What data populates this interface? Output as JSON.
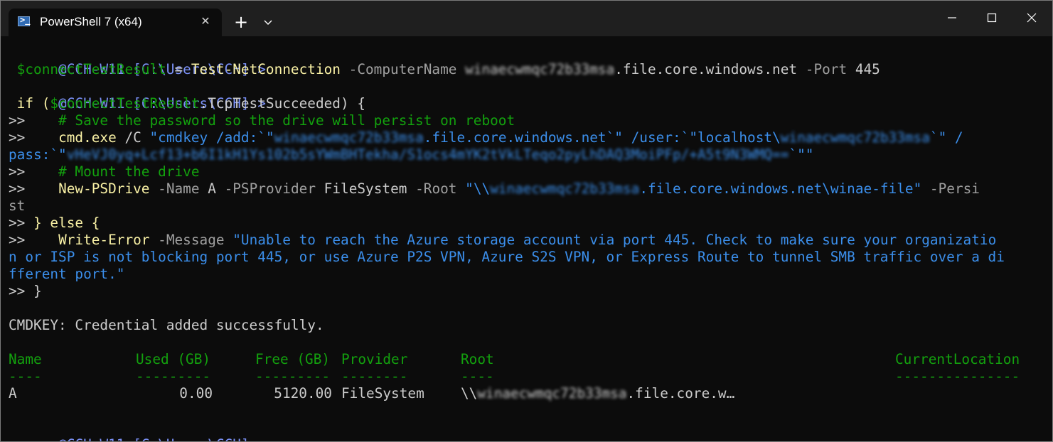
{
  "window": {
    "tab_title": "PowerShell 7 (x64)",
    "tab_icon": "powershell-icon",
    "tab_close_glyph": "✕",
    "new_tab_glyph": "+",
    "icons": [
      "powershell-icon",
      "close-icon",
      "plus-icon",
      "chevron-down-icon",
      "minimize-icon",
      "maximize-icon",
      "close-icon"
    ]
  },
  "terminal": {
    "prompt": "@CCH-W11 [C:\\Users\\CCH] >",
    "line1": {
      "var": " $connectTestResult",
      "eq": " = ",
      "cmd": "Test-NetConnection",
      "p1": " -ComputerName ",
      "acct": "winaecwmqc72b33msa",
      "host": ".file.core.windows.net",
      "p2": " -Port ",
      "port": "445"
    },
    "line2": {
      "if": " if (",
      "var": "$connectTestResult",
      "prop": ".TcpTestSucceeded) {"
    },
    "cont": ">>",
    "comment1": "    # Save the password so the drive will persist on reboot",
    "line_cmd": {
      "indent": "    ",
      "exe": "cmd.exe",
      "sw": " /C ",
      "s1": "\"cmdkey /add:`\"",
      "acct": "winaecwmqc72b33msa",
      "s2": ".file.core.windows.net`\" /user:`\"localhost\\",
      "acct2": "winaecwmqc72b33msa",
      "s3": "`\" /",
      "pass_label": "pass:`\"",
      "key": "vHeVJ0yq+Lcf13+b6I1kH1Ys102b5sYWmBHTekha/S1ocs4mYK2tVkLTeqo2pyLhDAQ3MoiPFp/+A5t9N3WMQ==",
      "s4": "`\"\""
    },
    "comment2": "    # Mount the drive",
    "line_mount": {
      "indent": "    ",
      "cmd": "New-PSDrive",
      "p1": " -Name ",
      "name": "A",
      "p2": " -PSProvider ",
      "provider": "FileSystem",
      "p3": " -Root ",
      "s1": "\"\\\\",
      "acct": "winaecwmqc72b33msa",
      "s2": ".file.core.windows.net\\winae-file\"",
      "p4": " -Persi",
      "wrap": "st"
    },
    "line_else": "} else {",
    "line_error": {
      "indent": "    ",
      "cmd": "Write-Error",
      "p1": " -Message ",
      "msg1": "\"Unable to reach the Azure storage account via port 445. Check to make sure your organizatio",
      "msg2": "n or ISP is not blocking port 445, or use Azure P2S VPN, Azure S2S VPN, or Express Route to tunnel SMB traffic over a di",
      "msg3": "fferent port.\""
    },
    "line_close": "}",
    "cmdkey_output": "CMDKEY: Credential added successfully.",
    "table": {
      "headers": [
        "Name",
        "Used (GB)",
        "Free (GB)",
        "Provider",
        "Root",
        "CurrentLocation"
      ],
      "dashes": [
        "----",
        "---------",
        "---------",
        "--------",
        "----",
        "---------------"
      ],
      "row": {
        "name": "A",
        "used": "0.00",
        "free": "5120.00",
        "provider": "FileSystem",
        "root_prefix": "\\\\",
        "root_acct": "winaecwmqc72b33msa",
        "root_suffix": ".file.core.w…"
      }
    }
  }
}
